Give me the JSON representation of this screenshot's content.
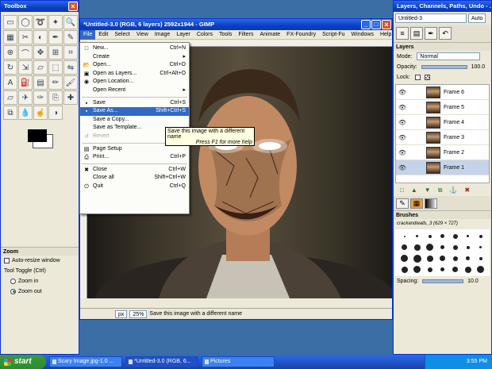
{
  "toolbox": {
    "title": "Toolbox",
    "tools": [
      {
        "icon": "rect-select-icon",
        "glyph": "▭"
      },
      {
        "icon": "ellipse-select-icon",
        "glyph": "◯"
      },
      {
        "icon": "free-select-icon",
        "glyph": "➰"
      },
      {
        "icon": "fuzzy-select-icon",
        "glyph": "✦"
      },
      {
        "icon": "magnify-icon",
        "glyph": "🔍"
      },
      {
        "icon": "select-by-color-icon",
        "glyph": "▦"
      },
      {
        "icon": "scissors-icon",
        "glyph": "✂"
      },
      {
        "icon": "foreground-select-icon",
        "glyph": "◐"
      },
      {
        "icon": "paths-icon",
        "glyph": "✒"
      },
      {
        "icon": "color-picker-icon",
        "glyph": "✎"
      },
      {
        "icon": "zoom-icon",
        "glyph": "⊕"
      },
      {
        "icon": "measure-icon",
        "glyph": "⌒"
      },
      {
        "icon": "move-icon",
        "glyph": "✥"
      },
      {
        "icon": "align-icon",
        "glyph": "⊞"
      },
      {
        "icon": "crop-icon",
        "glyph": "⌗"
      },
      {
        "icon": "rotate-icon",
        "glyph": "↻"
      },
      {
        "icon": "scale-icon",
        "glyph": "⇲"
      },
      {
        "icon": "shear-icon",
        "glyph": "▱"
      },
      {
        "icon": "perspective-icon",
        "glyph": "⬚"
      },
      {
        "icon": "flip-icon",
        "glyph": "⇋"
      },
      {
        "icon": "text-icon",
        "glyph": "A"
      },
      {
        "icon": "bucket-fill-icon",
        "glyph": "⛽"
      },
      {
        "icon": "blend-icon",
        "glyph": "▤"
      },
      {
        "icon": "pencil-icon",
        "glyph": "✏"
      },
      {
        "icon": "paintbrush-icon",
        "glyph": "🖌"
      },
      {
        "icon": "eraser-icon",
        "glyph": "▱"
      },
      {
        "icon": "airbrush-icon",
        "glyph": "✈"
      },
      {
        "icon": "ink-icon",
        "glyph": "✑"
      },
      {
        "icon": "clone-icon",
        "glyph": "⎘"
      },
      {
        "icon": "heal-icon",
        "glyph": "✚"
      },
      {
        "icon": "perspective-clone-icon",
        "glyph": "⧉"
      },
      {
        "icon": "blur-icon",
        "glyph": "💧"
      },
      {
        "icon": "smudge-icon",
        "glyph": "☝"
      },
      {
        "icon": "dodge-burn-icon",
        "glyph": "◑"
      }
    ],
    "zoom_panel": {
      "title": "Zoom",
      "auto_resize": "Auto-resize window",
      "toggle_label": "Tool Toggle  (Ctrl)",
      "zoom_in": "Zoom in",
      "zoom_out": "Zoom out"
    }
  },
  "gimp": {
    "title": "*Untitled-3.0 (RGB, 6 layers) 2592x1944 - GIMP",
    "menus": [
      "File",
      "Edit",
      "Select",
      "View",
      "Image",
      "Layer",
      "Colors",
      "Tools",
      "Filters",
      "Animate",
      "FX-Foundry",
      "Script-Fu",
      "Windows",
      "Help"
    ],
    "status": {
      "unit": "px",
      "zoom": "25%",
      "message": "Save this image with a different name"
    }
  },
  "file_menu": {
    "items": [
      {
        "label": "New...",
        "shortcut": "Ctrl+N",
        "icon": "new-icon",
        "glyph": "□"
      },
      {
        "label": "Create",
        "shortcut": "▸",
        "icon": "",
        "glyph": ""
      },
      {
        "label": "Open...",
        "shortcut": "Ctrl+O",
        "icon": "open-icon",
        "glyph": "📂"
      },
      {
        "label": "Open as Layers...",
        "shortcut": "Ctrl+Alt+O",
        "icon": "open-layers-icon",
        "glyph": "▣"
      },
      {
        "label": "Open Location...",
        "shortcut": "",
        "icon": "globe-icon",
        "glyph": "◉"
      },
      {
        "label": "Open Recent",
        "shortcut": "▸",
        "icon": "",
        "glyph": ""
      },
      {
        "sep": true
      },
      {
        "label": "Save",
        "shortcut": "Ctrl+S",
        "icon": "save-icon",
        "glyph": "▪"
      },
      {
        "label": "Save As...",
        "shortcut": "Shift+Ctrl+S",
        "icon": "save-as-icon",
        "glyph": "▪",
        "highlight": true
      },
      {
        "label": "Save a Copy...",
        "shortcut": "",
        "icon": "",
        "glyph": ""
      },
      {
        "label": "Save as Template...",
        "shortcut": "",
        "icon": "",
        "glyph": ""
      },
      {
        "label": "Revert",
        "shortcut": "",
        "icon": "revert-icon",
        "glyph": "↺",
        "disabled": true
      },
      {
        "sep": true
      },
      {
        "label": "Page Setup",
        "shortcut": "",
        "icon": "page-setup-icon",
        "glyph": "▤"
      },
      {
        "label": "Print...",
        "shortcut": "Ctrl+P",
        "icon": "print-icon",
        "glyph": "⎙"
      },
      {
        "sep": true
      },
      {
        "label": "Close",
        "shortcut": "Ctrl+W",
        "icon": "close-icon",
        "glyph": "✖"
      },
      {
        "label": "Close all",
        "shortcut": "Shift+Ctrl+W",
        "icon": "",
        "glyph": ""
      },
      {
        "label": "Quit",
        "shortcut": "Ctrl+Q",
        "icon": "quit-icon",
        "glyph": "⏻"
      }
    ]
  },
  "tooltip": {
    "text": "Save this image with a different name",
    "help": "Press F1 for more help"
  },
  "dock": {
    "title": "Layers, Channels, Paths, Undo - ...",
    "image_select": "Untitled-3",
    "auto_label": "Auto",
    "panel_title": "Layers",
    "mode_label": "Mode:",
    "mode_value": "Normal",
    "opacity_label": "Opacity:",
    "opacity_value": "100.0",
    "lock_label": "Lock:",
    "layers": [
      {
        "name": "Frame 6"
      },
      {
        "name": "Frame 5"
      },
      {
        "name": "Frame 4"
      },
      {
        "name": "Frame 3"
      },
      {
        "name": "Frame 2"
      },
      {
        "name": "Frame 1",
        "selected": true
      }
    ],
    "brushes_title": "Brushes",
    "brush_name": "crackandwalls_3 (629 × 727)",
    "spacing_label": "Spacing:",
    "spacing_value": "10.0"
  },
  "taskbar": {
    "start": "start",
    "tasks": [
      {
        "label": "Scary Image.jpg-1.0 ..."
      },
      {
        "label": "*Untitled-3.0 (RGB, 6...",
        "active": true
      },
      {
        "label": "Pictures"
      }
    ],
    "clock": "3:55 PM"
  }
}
